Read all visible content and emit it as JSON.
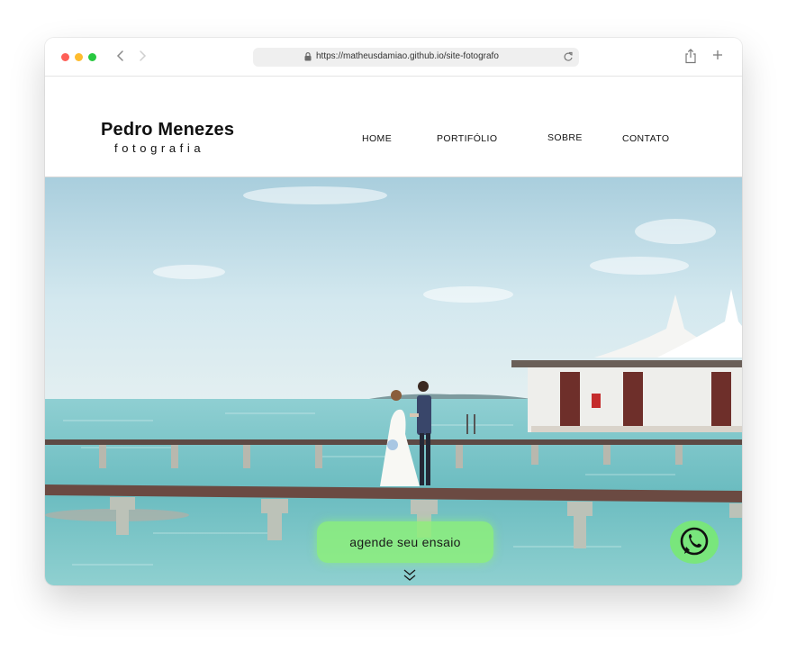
{
  "browser": {
    "url": "https://matheusdamiao.github.io/site-fotografo"
  },
  "site": {
    "logo_name": "Pedro Menezes",
    "logo_sub": "fotografia",
    "nav": [
      {
        "label": "HOME"
      },
      {
        "label": "PORTIFÓLIO"
      },
      {
        "label": "SOBRE"
      },
      {
        "label": "CONTATO"
      }
    ],
    "cta_label": "agende seu ensaio"
  },
  "icons": {
    "lock": "lock-icon",
    "reload": "reload-icon",
    "share": "share-icon",
    "new_tab": "plus-icon",
    "whatsapp": "whatsapp-icon",
    "scroll_down": "double-chevron-down-icon"
  },
  "colors": {
    "cta": "#8cf078",
    "whatsapp": "#78eb6e",
    "sky": "#cfe6ee",
    "sea": "#7cc3c6"
  }
}
